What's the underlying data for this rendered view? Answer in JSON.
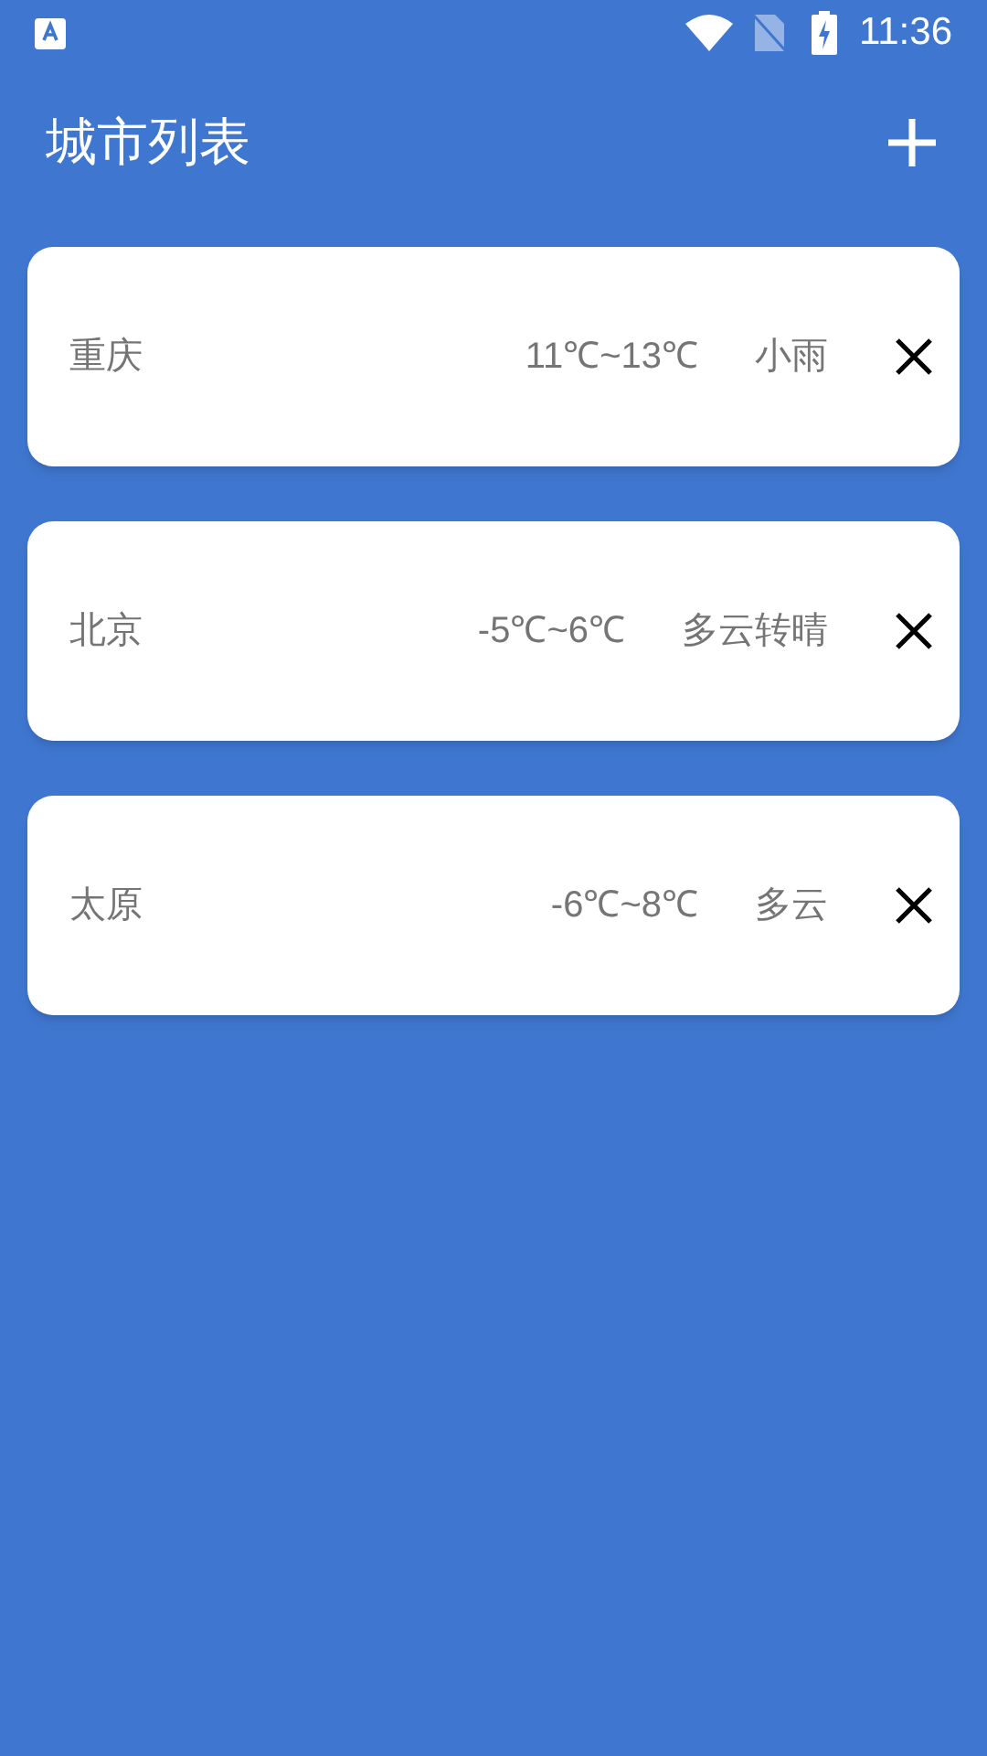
{
  "status_bar": {
    "time": "11:36"
  },
  "app_bar": {
    "title": "城市列表"
  },
  "cities": [
    {
      "name": "重庆",
      "temperature": "11℃~13℃",
      "weather": "小雨"
    },
    {
      "name": "北京",
      "temperature": "-5℃~6℃",
      "weather": "多云转晴"
    },
    {
      "name": "太原",
      "temperature": "-6℃~8℃",
      "weather": "多云"
    }
  ]
}
